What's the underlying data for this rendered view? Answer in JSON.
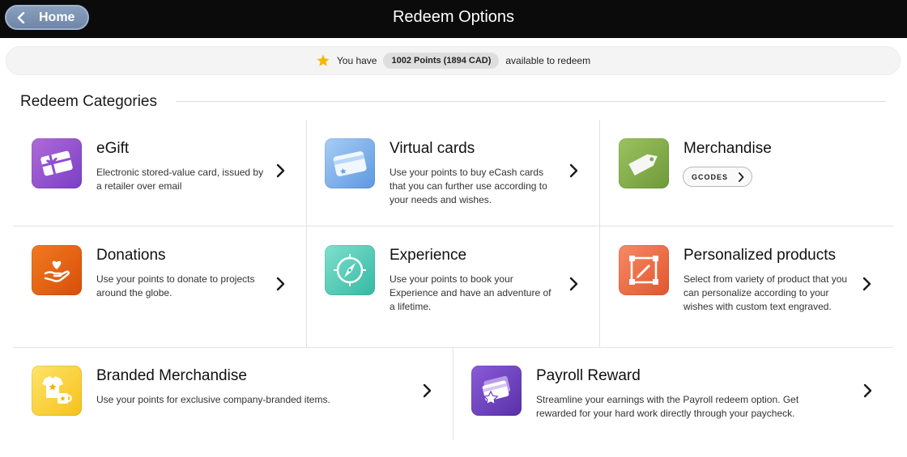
{
  "header": {
    "home_label": "Home",
    "title": "Redeem Options"
  },
  "points": {
    "prefix": "You have",
    "amount": "1002 Points (1894 CAD)",
    "suffix": "available to redeem"
  },
  "section": {
    "title": "Redeem Categories"
  },
  "colors": {
    "topbar": "#0b0b0b",
    "home_button": "#7a90b2",
    "star": "#f5b800"
  },
  "categories": [
    {
      "title": "eGift",
      "description": "Electronic stored-value card, issued by a retailer over email",
      "icon": "gift-card-icon"
    },
    {
      "title": "Virtual cards",
      "description": "Use your points to buy eCash cards that you can further use according to your needs and wishes.",
      "icon": "virtual-card-icon"
    },
    {
      "title": "Merchandise",
      "button_label": "GCODES",
      "icon": "price-tag-icon"
    },
    {
      "title": "Donations",
      "description": "Use your points to donate to projects around the globe.",
      "icon": "heart-hand-icon"
    },
    {
      "title": "Experience",
      "description": "Use your points to book your Experience and have an adventure of a lifetime.",
      "icon": "compass-icon"
    },
    {
      "title": "Personalized products",
      "description": "Select from variety of product that you can personalize according to your wishes with custom text engraved.",
      "icon": "edit-frame-icon"
    },
    {
      "title": "Branded Merchandise",
      "description": "Use your points for exclusive company-branded items.",
      "icon": "branded-shirt-mug-icon"
    },
    {
      "title": "Payroll Reward",
      "description": "Streamline your earnings with the Payroll redeem option. Get rewarded for your hard work directly through your paycheck.",
      "icon": "payroll-card-icon"
    }
  ]
}
